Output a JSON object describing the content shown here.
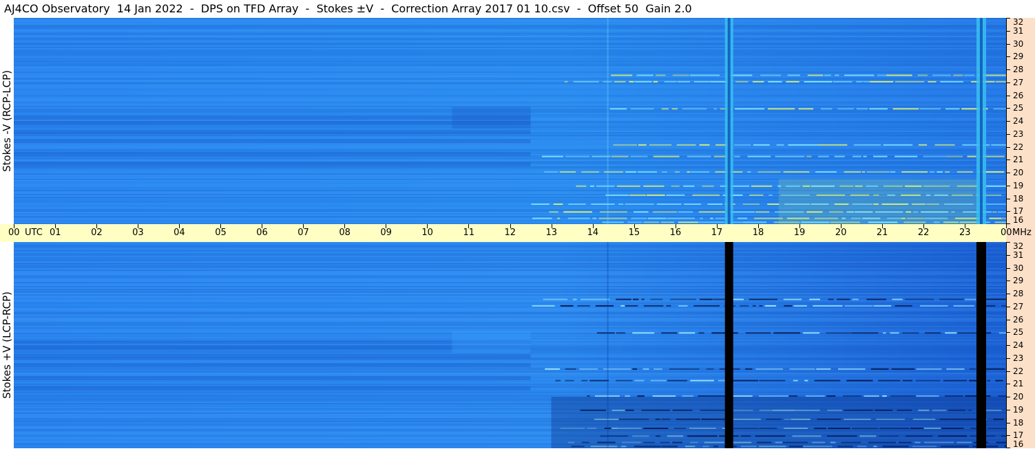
{
  "title": "AJ4CO Observatory  14 Jan 2022  -  DPS on TFD Array  -  Stokes ±V  -  Correction Array 2017 01 10.csv  -  Offset 50  Gain 2.0",
  "panels": {
    "top_label": "Stokes -V (RCP-LCP)",
    "bottom_label": "Stokes +V (LCP-RCP)"
  },
  "time_axis": {
    "ticks": [
      "00",
      "01",
      "02",
      "03",
      "04",
      "05",
      "06",
      "07",
      "08",
      "09",
      "10",
      "11",
      "12",
      "13",
      "14",
      "15",
      "16",
      "17",
      "18",
      "19",
      "20",
      "21",
      "22",
      "23",
      "00"
    ],
    "first_unit": "UTC",
    "freq_unit": "MHz"
  },
  "chart_data": {
    "type": "heatmap",
    "title": "AJ4CO Observatory  14 Jan 2022  -  DPS on TFD Array  -  Stokes ±V  -  Correction Array 2017 01 10.csv  -  Offset 50  Gain 2.0",
    "xlabel": "UTC",
    "ylabel": "MHz",
    "x_range_hours": [
      0,
      24
    ],
    "y_range_mhz": [
      16,
      32
    ],
    "freq_ticks": [
      32,
      31,
      30,
      29,
      28,
      27,
      26,
      25,
      24,
      23,
      22,
      21,
      20,
      19,
      18,
      17,
      16
    ],
    "series": [
      {
        "name": "Stokes -V (RCP-LCP)"
      },
      {
        "name": "Stokes +V (LCP-RCP)"
      }
    ],
    "colors": {
      "background": "#1e78e8",
      "top_mid": "#2a8cf0",
      "band_dark": "#1a5fcc",
      "bright": "#b4f078",
      "black_bar": "#000000",
      "cyan_bar": "#38c0f0",
      "axis_band": "#ffffc4",
      "freq_column": "#fce0c8"
    },
    "vertical_features_hours": [
      17.3,
      23.4
    ]
  }
}
